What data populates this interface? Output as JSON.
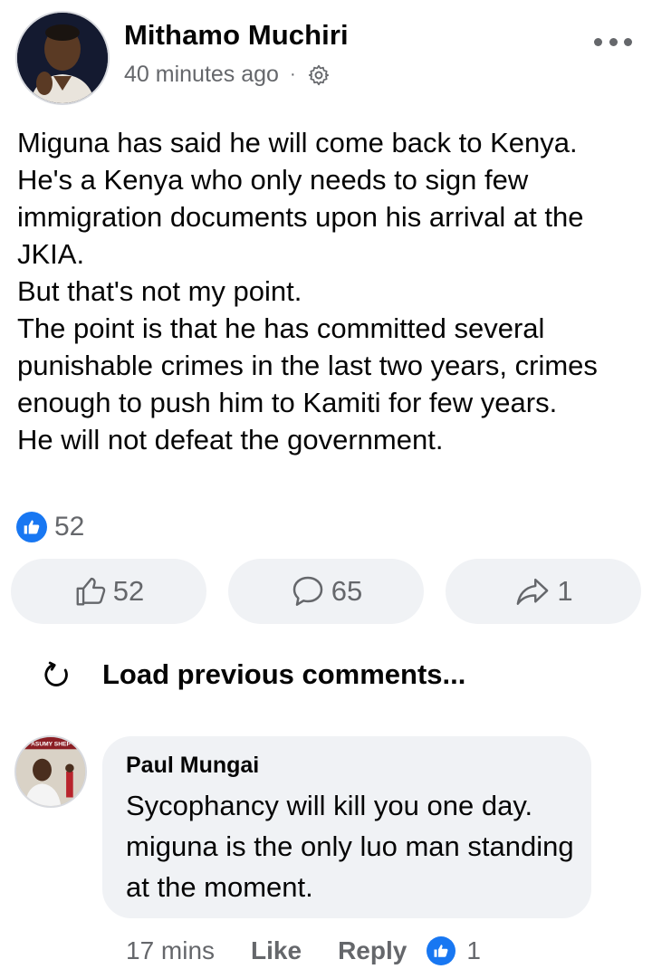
{
  "post": {
    "author": "Mithamo Muchiri",
    "time": "40 minutes ago",
    "separator": "·",
    "body": "Miguna has said he will come back to Kenya.\nHe's a Kenya who only needs to sign few immigration documents upon his arrival at the JKIA.\nBut that's not my point.\nThe point is that he has committed several punishable crimes in the last two years, crimes enough to push him to Kamiti for few years.\nHe will not defeat the government.",
    "reaction_count": "52",
    "icons": {
      "more": "more-options-icon",
      "privacy": "gear-icon"
    }
  },
  "actions": {
    "like_count": "52",
    "comment_count": "65",
    "share_count": "1"
  },
  "comments": {
    "load_previous_label": "Load previous comments...",
    "items": [
      {
        "author": "Paul Mungai",
        "avatar_badge_text": "ASUMY SHEP",
        "text": "Sycophancy will kill you one day.\nmiguna is the only luo man standing at the moment.",
        "time": "17 mins",
        "like_label": "Like",
        "reply_label": "Reply",
        "reaction_count": "1"
      }
    ]
  },
  "colors": {
    "accent": "#1877f2",
    "secondary_text": "#65676b",
    "button_bg": "#f0f2f5"
  }
}
